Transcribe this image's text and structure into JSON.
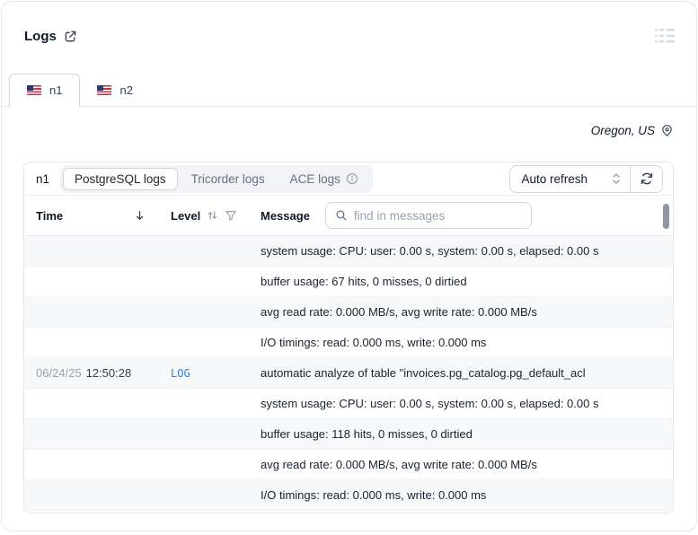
{
  "header": {
    "title": "Logs"
  },
  "tabs": [
    {
      "label": "n1",
      "active": true
    },
    {
      "label": "n2",
      "active": false
    }
  ],
  "region": {
    "label": "Oregon, US"
  },
  "panel": {
    "node_label": "n1",
    "log_sources": [
      {
        "label": "PostgreSQL logs",
        "active": true
      },
      {
        "label": "Tricorder logs",
        "active": false
      },
      {
        "label": "ACE logs",
        "active": false,
        "has_info": true
      }
    ],
    "auto_refresh_label": "Auto refresh"
  },
  "table": {
    "columns": {
      "time": "Time",
      "level": "Level",
      "message": "Message"
    },
    "search_placeholder": "find in messages",
    "rows": [
      {
        "date": "",
        "time": "",
        "level": "",
        "message": "system usage: CPU: user: 0.00 s, system: 0.00 s, elapsed: 0.00 s"
      },
      {
        "date": "",
        "time": "",
        "level": "",
        "message": "buffer usage: 67 hits, 0 misses, 0 dirtied"
      },
      {
        "date": "",
        "time": "",
        "level": "",
        "message": "avg read rate: 0.000 MB/s, avg write rate: 0.000 MB/s"
      },
      {
        "date": "",
        "time": "",
        "level": "",
        "message": "I/O timings: read: 0.000 ms, write: 0.000 ms"
      },
      {
        "date": "06/24/25",
        "time": "12:50:28",
        "level": "LOG",
        "message": "automatic analyze of table \"invoices.pg_catalog.pg_default_acl"
      },
      {
        "date": "",
        "time": "",
        "level": "",
        "message": "system usage: CPU: user: 0.00 s, system: 0.00 s, elapsed: 0.00 s"
      },
      {
        "date": "",
        "time": "",
        "level": "",
        "message": "buffer usage: 118 hits, 0 misses, 0 dirtied"
      },
      {
        "date": "",
        "time": "",
        "level": "",
        "message": "avg read rate: 0.000 MB/s, avg write rate: 0.000 MB/s"
      },
      {
        "date": "",
        "time": "",
        "level": "",
        "message": "I/O timings: read: 0.000 ms, write: 0.000 ms"
      }
    ]
  },
  "colors": {
    "accent_blue": "#2f80ed",
    "stripe": "#f7f8fa",
    "border_light": "#e4e7ec",
    "border_control": "#d0d5dd",
    "text_dark": "#101828",
    "text_muted": "#667085",
    "text_faint": "#98a2b3"
  }
}
